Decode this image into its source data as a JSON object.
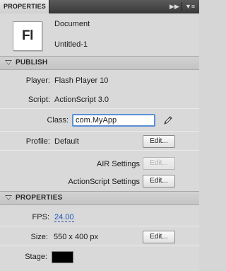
{
  "panel": {
    "tab_label": "PROPERTIES"
  },
  "document": {
    "icon_text": "Fl",
    "type": "Document",
    "name": "Untitled-1"
  },
  "publish": {
    "header": "PUBLISH",
    "player_label": "Player:",
    "player_value": "Flash Player 10",
    "script_label": "Script:",
    "script_value": "ActionScript 3.0",
    "class_label": "Class:",
    "class_value": "com.MyApp",
    "profile_label": "Profile:",
    "profile_value": "Default",
    "profile_edit": "Edit...",
    "air_settings_label": "AIR Settings",
    "air_settings_edit": "Edit...",
    "as_settings_label": "ActionScript Settings",
    "as_settings_edit": "Edit..."
  },
  "properties": {
    "header": "PROPERTIES",
    "fps_label": "FPS:",
    "fps_value": "24.00",
    "size_label": "Size:",
    "size_value": "550 x 400 px",
    "size_edit": "Edit...",
    "stage_label": "Stage:",
    "stage_color": "#000000"
  }
}
